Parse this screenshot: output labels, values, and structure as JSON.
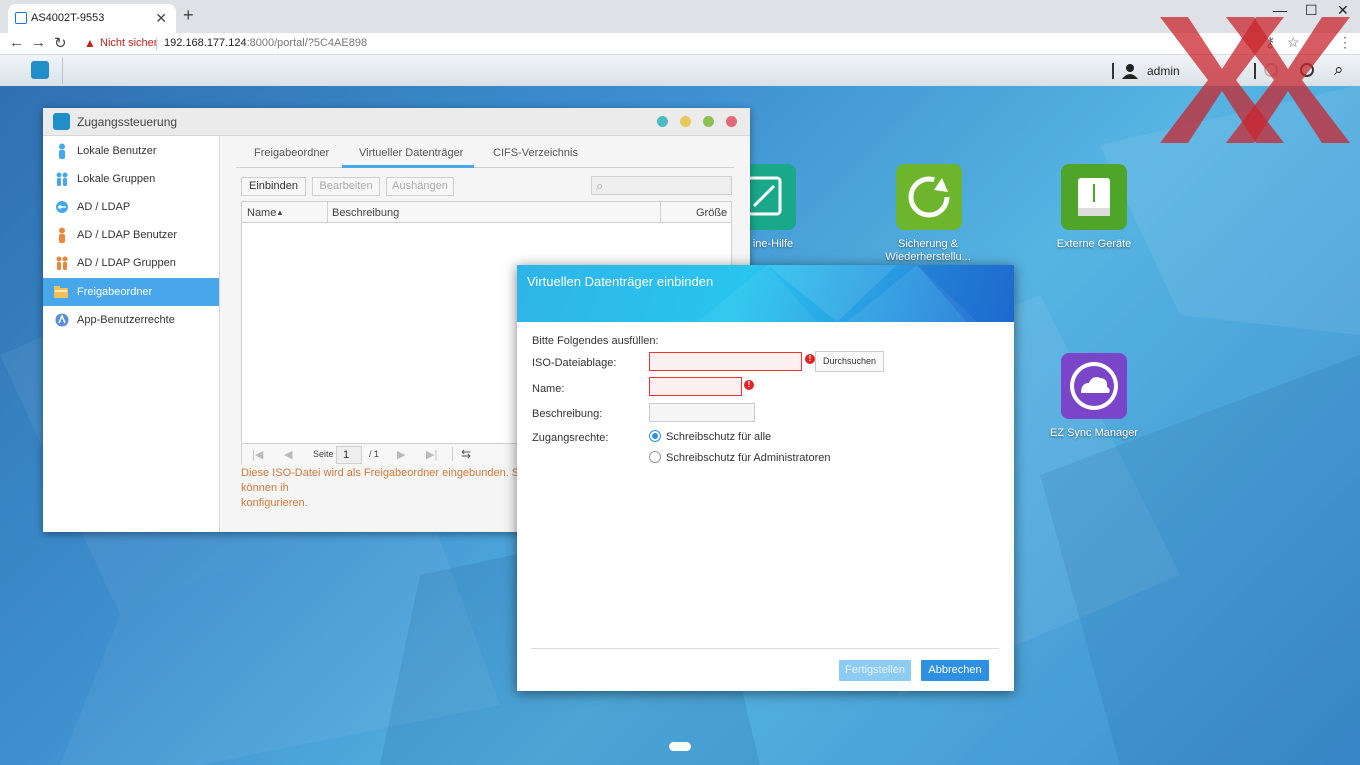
{
  "browser": {
    "tab_title": "AS4002T-9553",
    "new_tab": "+",
    "insecure_label": "Nicht sicher",
    "url_host": "192.168.177.124",
    "url_rest": ":8000/portal/?5C4AE898"
  },
  "taskbar": {
    "user": "admin"
  },
  "desktop": {
    "icons": [
      {
        "label": "Online-Hilfe",
        "visible_label": "ine-Hilfe",
        "icon": "help-compass-icon",
        "color": "#1aa88a"
      },
      {
        "label": "Sicherung & Wiederherstellu...",
        "line1": "Sicherung &",
        "line2": "Wiederherstellu...",
        "icon": "backup-restore-icon",
        "color": "#6cb52d"
      },
      {
        "label": "Externe Geräte",
        "icon": "external-devices-icon",
        "color": "#4ea52a"
      },
      {
        "label": "EZ Sync Manager",
        "icon": "ez-sync-cloud-icon",
        "color": "#7a45c8"
      }
    ]
  },
  "window": {
    "title": "Zugangssteuerung",
    "sidebar": [
      {
        "label": "Lokale Benutzer",
        "icon": "user-icon",
        "color": "#47a7ea"
      },
      {
        "label": "Lokale Gruppen",
        "icon": "group-icon",
        "color": "#47a7ea"
      },
      {
        "label": "AD / LDAP",
        "icon": "ldap-key-icon",
        "color": "#47a7ea"
      },
      {
        "label": "AD / LDAP Benutzer",
        "icon": "ldap-user-icon",
        "color": "#e9863c"
      },
      {
        "label": "AD / LDAP Gruppen",
        "icon": "ldap-group-icon",
        "color": "#e9863c"
      },
      {
        "label": "Freigabeordner",
        "icon": "folder-icon",
        "color": "#f3c05a",
        "selected": true
      },
      {
        "label": "App-Benutzerrechte",
        "icon": "app-permissions-icon",
        "color": "#5a8fd8"
      }
    ],
    "tabs": [
      "Freigabeordner",
      "Virtueller Datenträger",
      "CIFS-Verzeichnis"
    ],
    "active_tab": 1,
    "toolbar": {
      "mount": "Einbinden",
      "edit": "Bearbeiten",
      "unmount": "Aushängen"
    },
    "columns": {
      "name": "Name",
      "description": "Beschreibung",
      "size": "Größe"
    },
    "pager": {
      "page_label": "Seite",
      "page_value": "1",
      "total": "/ 1"
    },
    "note": "Diese ISO-Datei wird als Freigabeordner eingebunden. Sie können ih",
    "note2": "konfigurieren."
  },
  "dialog": {
    "title": "Virtuellen Datenträger einbinden",
    "intro": "Bitte Folgendes ausfüllen:",
    "iso_label": "ISO-Dateiablage:",
    "browse": "Durchsuchen",
    "name_label": "Name:",
    "desc_label": "Beschreibung:",
    "access_label": "Zugangsrechte:",
    "options": [
      "Schreibschutz für alle",
      "Schreibschutz für Administratoren"
    ],
    "selected_option": 0,
    "finish": "Fertigstellen",
    "cancel": "Abbrechen",
    "error_mark": "!"
  }
}
